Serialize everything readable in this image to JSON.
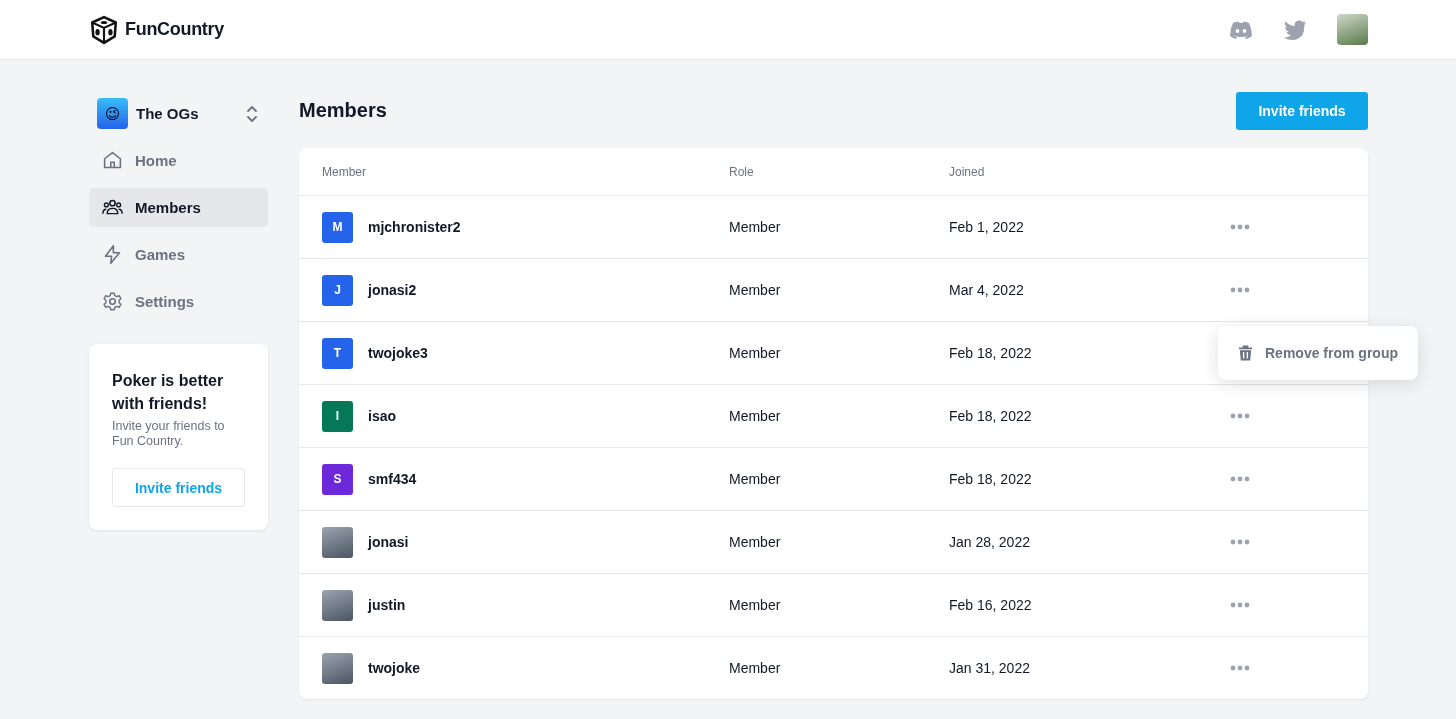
{
  "header": {
    "brand": "FunCountry"
  },
  "sidebar": {
    "group": {
      "name": "The OGs",
      "emoji": "😉"
    },
    "items": [
      {
        "label": "Home",
        "selected": false
      },
      {
        "label": "Members",
        "selected": true
      },
      {
        "label": "Games",
        "selected": false
      },
      {
        "label": "Settings",
        "selected": false
      }
    ],
    "promo": {
      "title": "Poker is better with friends!",
      "text": "Invite your friends to Fun Country.",
      "button": "Invite friends"
    }
  },
  "main": {
    "title": "Members",
    "button": "Invite friends",
    "table": {
      "columns": [
        "Member",
        "Role",
        "Joined"
      ],
      "rows": [
        {
          "avatar": {
            "kind": "initial",
            "letter": "M",
            "color": "#2563eb"
          },
          "name": "mjchronister2",
          "role": "Member",
          "joined": "Feb 1, 2022",
          "menu_open": false
        },
        {
          "avatar": {
            "kind": "initial",
            "letter": "J",
            "color": "#2563eb"
          },
          "name": "jonasi2",
          "role": "Member",
          "joined": "Mar 4, 2022",
          "menu_open": false
        },
        {
          "avatar": {
            "kind": "initial",
            "letter": "T",
            "color": "#2563eb"
          },
          "name": "twojoke3",
          "role": "Member",
          "joined": "Feb 18, 2022",
          "menu_open": true
        },
        {
          "avatar": {
            "kind": "initial",
            "letter": "I",
            "color": "#047857"
          },
          "name": "isao",
          "role": "Member",
          "joined": "Feb 18, 2022",
          "menu_open": false
        },
        {
          "avatar": {
            "kind": "initial",
            "letter": "S",
            "color": "#6d28d9"
          },
          "name": "smf434",
          "role": "Member",
          "joined": "Feb 18, 2022",
          "menu_open": false
        },
        {
          "avatar": {
            "kind": "photo"
          },
          "name": "jonasi",
          "role": "Member",
          "joined": "Jan 28, 2022",
          "menu_open": false
        },
        {
          "avatar": {
            "kind": "photo"
          },
          "name": "justin",
          "role": "Member",
          "joined": "Feb 16, 2022",
          "menu_open": false
        },
        {
          "avatar": {
            "kind": "photo"
          },
          "name": "twojoke",
          "role": "Member",
          "joined": "Jan 31, 2022",
          "menu_open": false
        }
      ],
      "row_menu": {
        "items": [
          "Remove from group"
        ]
      }
    }
  }
}
